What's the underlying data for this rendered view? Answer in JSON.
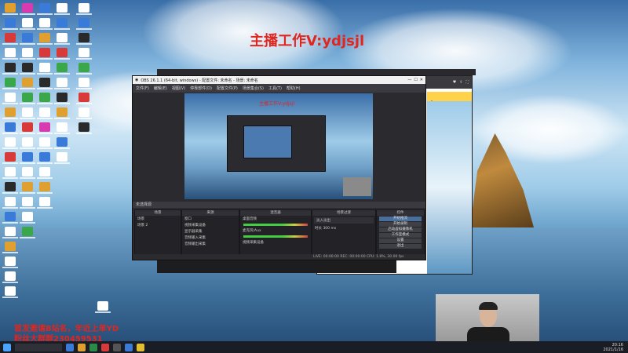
{
  "watermark": {
    "top": "主播工作V:ydjsjl"
  },
  "bottom_lines": [
    "首发邀请B站名，年近上单YD",
    "粉丝大群群230459531"
  ],
  "obs": {
    "title": "OBS 26.1.1 (64-bit, windows) - 配置文件: 未命名 - 场景: 未命名",
    "menu": [
      "文件(F)",
      "编辑(E)",
      "视图(V)",
      "停靠部件(D)",
      "配置文件(P)",
      "场景集合(S)",
      "工具(T)",
      "帮助(H)"
    ],
    "preview_watermark": "主播工作V:ydjsjl",
    "dock_header": "未选择源",
    "docks": {
      "scenes": {
        "title": "场景",
        "items": [
          "场景",
          "场景 2"
        ]
      },
      "sources": {
        "title": "来源",
        "items": [
          "窗口",
          "视频采集设备",
          "显示器采集",
          "音频输入采集",
          "音频输出采集"
        ]
      },
      "mixer": {
        "title": "混音器",
        "items": [
          "桌面音频",
          "麦克风/Aux",
          "视频采集设备"
        ]
      },
      "transitions": {
        "title": "场景过渡",
        "type": "淡入淡出",
        "duration_label": "时长",
        "duration_value": "300 ms"
      },
      "controls": {
        "title": "控件",
        "buttons": [
          "开始推流",
          "开始录制",
          "启动虚拟摄像机",
          "工作室模式",
          "设置",
          "退出"
        ]
      }
    },
    "status": "LIVE: 00:00:00   REC: 00:00:00   CPU: 1.8%, 30.00 fps"
  },
  "browser": {
    "cfhd_text": "CFHD高清传送..."
  },
  "taskbar": {
    "clock_time": "20:16",
    "clock_date": "2021/1/16"
  },
  "colors": {
    "watermark": "#e0261f",
    "obs_bg": "#2b2b2f",
    "taskbar": "#1b1d24",
    "stream_btn": "#4a6e9a"
  }
}
